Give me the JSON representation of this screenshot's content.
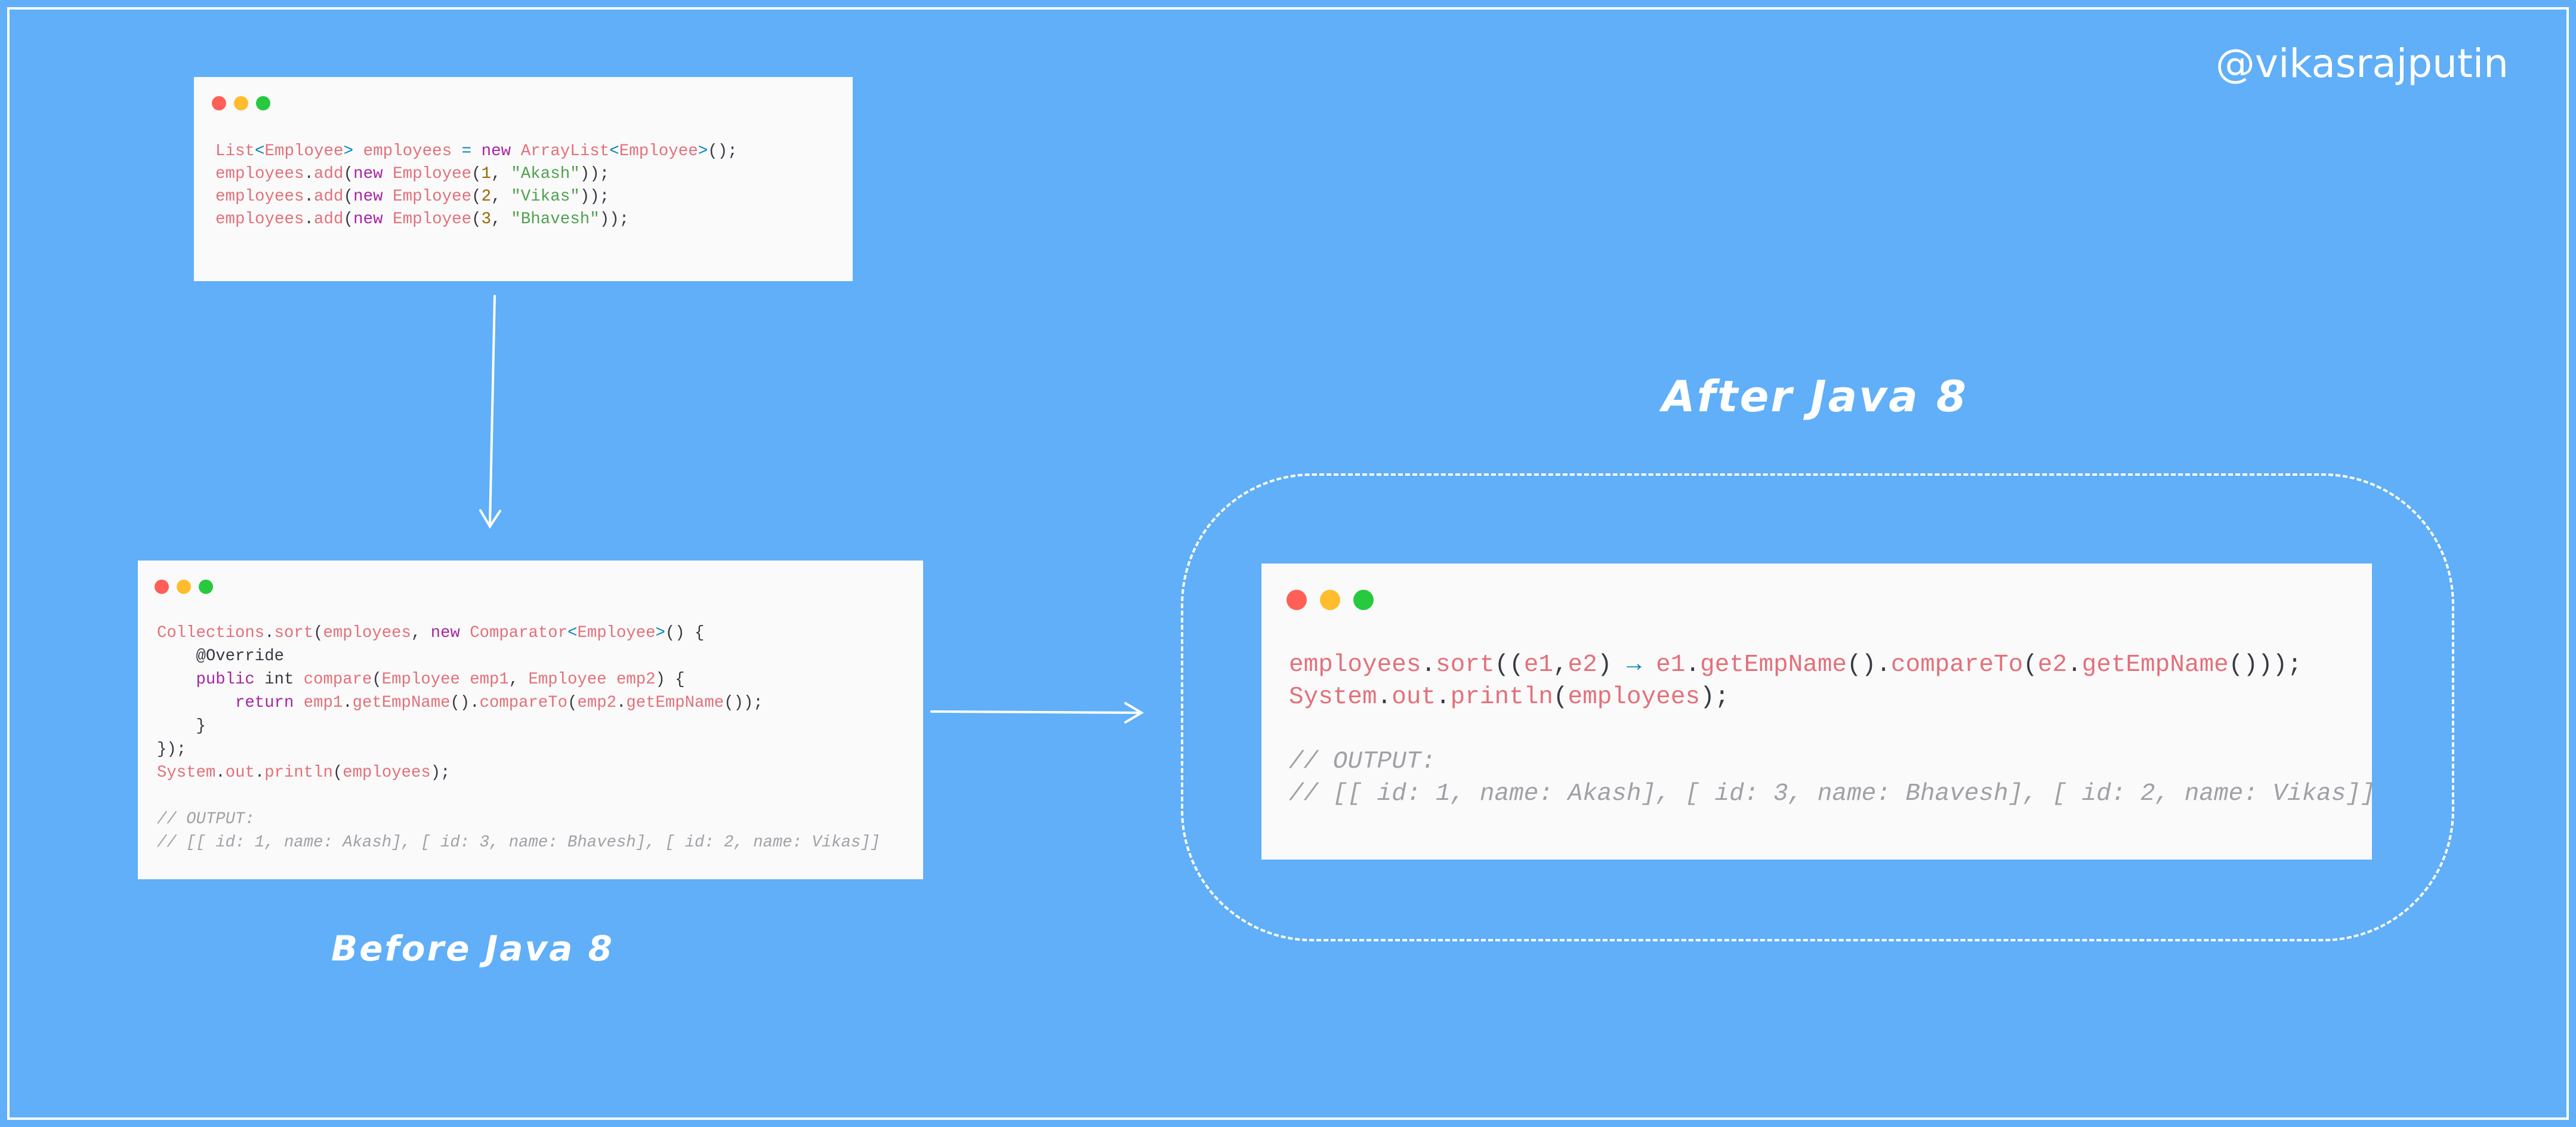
{
  "watermark": "@vikasrajputin",
  "labels": {
    "before": "Before Java 8",
    "after": "After Java 8"
  },
  "colors": {
    "background": "#60aff8",
    "card": "#fafafa",
    "dot_red": "#ff5f56",
    "dot_yellow": "#ffbd2e",
    "dot_green": "#27c93f"
  },
  "snippets": {
    "setup": [
      [
        [
          "List",
          "fn"
        ],
        [
          "<",
          "op"
        ],
        [
          "Employee",
          "fn"
        ],
        [
          ">",
          "op"
        ],
        [
          " ",
          "pl"
        ],
        [
          "employees",
          "fn"
        ],
        [
          " ",
          "pl"
        ],
        [
          "=",
          "op"
        ],
        [
          " ",
          "pl"
        ],
        [
          "new",
          "kw"
        ],
        [
          " ",
          "pl"
        ],
        [
          "ArrayList",
          "fn"
        ],
        [
          "<",
          "op"
        ],
        [
          "Employee",
          "fn"
        ],
        [
          ">",
          "op"
        ],
        [
          "();",
          "pl"
        ]
      ],
      [
        [
          "employees",
          "fn"
        ],
        [
          ".",
          "pl"
        ],
        [
          "add",
          "fn"
        ],
        [
          "(",
          "pl"
        ],
        [
          "new",
          "kw"
        ],
        [
          " ",
          "pl"
        ],
        [
          "Employee",
          "fn"
        ],
        [
          "(",
          "pl"
        ],
        [
          "1",
          "num"
        ],
        [
          ", ",
          "pl"
        ],
        [
          "\"Akash\"",
          "str"
        ],
        [
          "));",
          "pl"
        ]
      ],
      [
        [
          "employees",
          "fn"
        ],
        [
          ".",
          "pl"
        ],
        [
          "add",
          "fn"
        ],
        [
          "(",
          "pl"
        ],
        [
          "new",
          "kw"
        ],
        [
          " ",
          "pl"
        ],
        [
          "Employee",
          "fn"
        ],
        [
          "(",
          "pl"
        ],
        [
          "2",
          "num"
        ],
        [
          ", ",
          "pl"
        ],
        [
          "\"Vikas\"",
          "str"
        ],
        [
          "));",
          "pl"
        ]
      ],
      [
        [
          "employees",
          "fn"
        ],
        [
          ".",
          "pl"
        ],
        [
          "add",
          "fn"
        ],
        [
          "(",
          "pl"
        ],
        [
          "new",
          "kw"
        ],
        [
          " ",
          "pl"
        ],
        [
          "Employee",
          "fn"
        ],
        [
          "(",
          "pl"
        ],
        [
          "3",
          "num"
        ],
        [
          ", ",
          "pl"
        ],
        [
          "\"Bhavesh\"",
          "str"
        ],
        [
          "));",
          "pl"
        ]
      ]
    ],
    "before": [
      [
        [
          "Collections",
          "fn"
        ],
        [
          ".",
          "pl"
        ],
        [
          "sort",
          "fn"
        ],
        [
          "(",
          "pl"
        ],
        [
          "employees",
          "fn"
        ],
        [
          ", ",
          "pl"
        ],
        [
          "new",
          "kw"
        ],
        [
          " ",
          "pl"
        ],
        [
          "Comparator",
          "fn"
        ],
        [
          "<",
          "op"
        ],
        [
          "Employee",
          "fn"
        ],
        [
          ">",
          "op"
        ],
        [
          "() {",
          "pl"
        ]
      ],
      [
        [
          "    @Override",
          "pl"
        ]
      ],
      [
        [
          "    ",
          "pl"
        ],
        [
          "public",
          "kw"
        ],
        [
          " int ",
          "pl"
        ],
        [
          "compare",
          "fn"
        ],
        [
          "(",
          "pl"
        ],
        [
          "Employee emp1",
          "fn"
        ],
        [
          ", ",
          "pl"
        ],
        [
          "Employee emp2",
          "fn"
        ],
        [
          ") {",
          "pl"
        ]
      ],
      [
        [
          "        ",
          "pl"
        ],
        [
          "return",
          "kw"
        ],
        [
          " ",
          "pl"
        ],
        [
          "emp1",
          "fn"
        ],
        [
          ".",
          "pl"
        ],
        [
          "getEmpName",
          "fn"
        ],
        [
          "().",
          "pl"
        ],
        [
          "compareTo",
          "fn"
        ],
        [
          "(",
          "pl"
        ],
        [
          "emp2",
          "fn"
        ],
        [
          ".",
          "pl"
        ],
        [
          "getEmpName",
          "fn"
        ],
        [
          "());",
          "pl"
        ]
      ],
      [
        [
          "    }",
          "pl"
        ]
      ],
      [
        [
          "});",
          "pl"
        ]
      ],
      [
        [
          "System",
          "fn"
        ],
        [
          ".",
          "pl"
        ],
        [
          "out",
          "fn"
        ],
        [
          ".",
          "pl"
        ],
        [
          "println",
          "fn"
        ],
        [
          "(",
          "pl"
        ],
        [
          "employees",
          "fn"
        ],
        [
          ");",
          "pl"
        ]
      ],
      [
        [
          " ",
          "pl"
        ]
      ],
      [
        [
          "// OUTPUT:",
          "cm"
        ]
      ],
      [
        [
          "// [[ id: 1, name: Akash], [ id: 3, name: Bhavesh], [ id: 2, name: Vikas]]",
          "cm"
        ]
      ]
    ],
    "after": [
      [
        [
          "employees",
          "fn"
        ],
        [
          ".",
          "pl"
        ],
        [
          "sort",
          "fn"
        ],
        [
          "((",
          "pl"
        ],
        [
          "e1",
          "fn"
        ],
        [
          ",",
          "pl"
        ],
        [
          "e2",
          "fn"
        ],
        [
          ") ",
          "pl"
        ],
        [
          "→",
          "op"
        ],
        [
          " ",
          "pl"
        ],
        [
          "e1",
          "fn"
        ],
        [
          ".",
          "pl"
        ],
        [
          "getEmpName",
          "fn"
        ],
        [
          "().",
          "pl"
        ],
        [
          "compareTo",
          "fn"
        ],
        [
          "(",
          "pl"
        ],
        [
          "e2",
          "fn"
        ],
        [
          ".",
          "pl"
        ],
        [
          "getEmpName",
          "fn"
        ],
        [
          "()));",
          "pl"
        ]
      ],
      [
        [
          "System",
          "fn"
        ],
        [
          ".",
          "pl"
        ],
        [
          "out",
          "fn"
        ],
        [
          ".",
          "pl"
        ],
        [
          "println",
          "fn"
        ],
        [
          "(",
          "pl"
        ],
        [
          "employees",
          "fn"
        ],
        [
          ");",
          "pl"
        ]
      ],
      [
        [
          " ",
          "pl"
        ]
      ],
      [
        [
          "// OUTPUT:",
          "cm"
        ]
      ],
      [
        [
          "// [[ id: 1, name: Akash], [ id: 3, name: Bhavesh], [ id: 2, name: Vikas]]",
          "cm"
        ]
      ]
    ]
  }
}
